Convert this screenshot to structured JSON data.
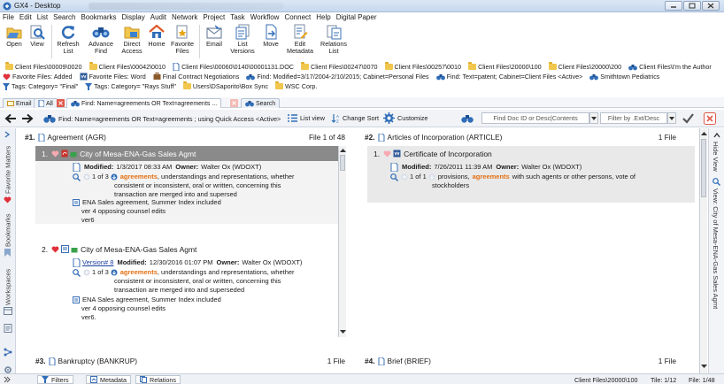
{
  "window": {
    "title": "GX4 - Desktop"
  },
  "menu": [
    "File",
    "Edit",
    "List",
    "Search",
    "Bookmarks",
    "Display",
    "Audit",
    "Network",
    "Project",
    "Task",
    "Workflow",
    "Connect",
    "Help",
    "Digital Paper"
  ],
  "ribbon": {
    "open": "Open",
    "view": "View",
    "refresh_1": "Refresh",
    "refresh_2": "List",
    "advance_1": "Advance",
    "advance_2": "Find",
    "direct_1": "Direct",
    "direct_2": "Access",
    "home": "Home",
    "favorite_1": "Favorite",
    "favorite_2": "Files",
    "email": "Email",
    "list_1": "List",
    "list_2": "Versions",
    "move": "Move",
    "edit_1": "Edit",
    "edit_2": "Metadata",
    "relations_1": "Relations",
    "relations_2": "List"
  },
  "favorites_row1": [
    "Client Files\\00009\\0020",
    "Client Files\\00042\\0010",
    "Client Files\\00060\\0140\\00001131.DOC",
    "Client Files\\00247\\0070",
    "Client Files\\00257\\0010",
    "Client Files\\20000\\100",
    "Client Files\\20000\\200",
    "Client Files\\I'm the Author"
  ],
  "favorites_row2": [
    "Favorite Files: Added",
    "Favorite Files: Word",
    "Final Contract Negotiations",
    "Find: Modified=3/17/2004-2/10/2015; Cabinet=Personal Files",
    "Find: Text=patent; Cabinet=Client Files <Active>",
    "Smithtown Pediatrics"
  ],
  "favorites_row3": [
    "Tags: Category= \"Final\"",
    "Tags: Category= \"Rays Stuff\"",
    "Users\\DSaporito\\Box Sync",
    "WSC Corp."
  ],
  "tabs": {
    "email": "Email",
    "all": "All",
    "find": "Find: Name=agreements OR Text=agreements ...",
    "search": "Search"
  },
  "nav": {
    "query": "Find: Name=agreements OR Text=agreements ; using Quick Access <Active>",
    "list_view": "List view",
    "change_sort": "Change Sort",
    "customize": "Customize",
    "find_doc_placeholder": "Find Doc ID or Desc|Contents",
    "filter_placeholder": "Filter by .Ext/Desc"
  },
  "left_strip": {
    "favorite_matters": "Favorite Matters",
    "bookmarks": "Bookmarks",
    "workspaces": "Workspaces"
  },
  "right_strip": {
    "hide_view": "Hide View",
    "view_title": "View: City of Mesa-ENA-Gas Sales Agmt"
  },
  "panels": {
    "p1": {
      "num": "#1.",
      "name": "Agreement (AGR)",
      "count": "File 1 of 48"
    },
    "p2": {
      "num": "#2.",
      "name": "Articles of Incorporation (ARTICLE)",
      "count": "1 File"
    },
    "p3": {
      "num": "#3.",
      "name": "Bankruptcy (BANKRUP)",
      "count": "1 File"
    },
    "p4": {
      "num": "#4.",
      "name": "Brief (BRIEF)",
      "count": "1 File"
    }
  },
  "items": {
    "a1": {
      "index": "1.",
      "title": "City of Mesa-ENA-Gas Sales Agmt",
      "modified_label": "Modified:",
      "modified": "1/3/2017 08:33 AM",
      "owner_label": "Owner:",
      "owner": "Walter Ox (WDOXT)",
      "hits": "1 of 3",
      "keyword": "agreements",
      "snippet_1": ", understandings and representations, whether",
      "snippet_2": "consistent or inconsistent, oral or written, concerning this",
      "snippet_3": "transaction are merged into and supersed",
      "note_1": "ENA Sales agreement, Summer Index included",
      "note_2": "ver 4 opposing counsel edits",
      "note_3": "ver6"
    },
    "a2": {
      "index": "2.",
      "title": "City of Mesa-ENA-Gas Sales Agmt",
      "version": "Version# 8",
      "modified_label": "Modified:",
      "modified": "12/30/2016 01:07 PM",
      "owner_label": "Owner:",
      "owner": "Walter Ox (WDOXT)",
      "hits": "1 of 3",
      "keyword": "agreements",
      "snippet_1": ", understandings and representations, whether",
      "snippet_2": "consistent or inconsistent, oral or written, concerning this",
      "snippet_3": "transaction are merged into and superseded",
      "note_1": "ENA Sales agreement, Summer Index included",
      "note_2": "ver 4 opposing counsel edits",
      "note_3": "ver6."
    },
    "b1": {
      "index": "1.",
      "title": "Certificate of Incorporation",
      "modified_label": "Modified:",
      "modified": "7/26/2011 11:39 AM",
      "owner_label": "Owner:",
      "owner": "Walter Ox (WDOXT)",
      "hits": "1 of 1",
      "pre": "provisions,",
      "keyword": "agreements",
      "snippet_1": "with such agents or other persons, vote of",
      "snippet_2": "stockholders"
    }
  },
  "bottom": {
    "filters": "Filters",
    "metadata": "Metadata",
    "relations": "Relations",
    "path": "Client Files\\20000\\100",
    "tile": "Tile: 1/12",
    "file": "File: 1/48"
  },
  "colors": {
    "accent": "#3a6fb6",
    "selected_row": "#8a8a8a",
    "keyword": "#e46f12",
    "heart": "#e0303a"
  }
}
